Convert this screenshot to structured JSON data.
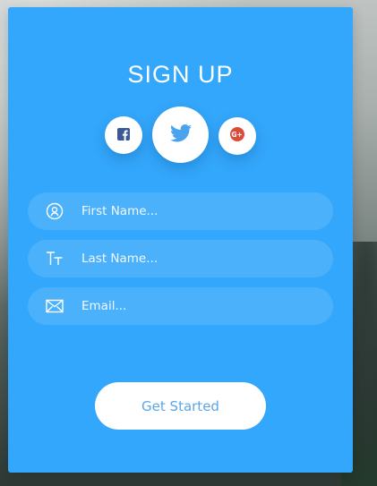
{
  "card": {
    "title": "SIGN UP"
  },
  "social": [
    {
      "network": "facebook",
      "icon": "facebook-icon",
      "color": "#3b5998"
    },
    {
      "network": "twitter",
      "icon": "twitter-icon",
      "color": "#55acee"
    },
    {
      "network": "google-plus",
      "icon": "google-plus-icon",
      "color": "#dd4b39"
    }
  ],
  "fields": {
    "first_name": {
      "icon": "user-circle-icon",
      "placeholder": "First Name..."
    },
    "last_name": {
      "icon": "text-size-icon",
      "placeholder": "Last Name..."
    },
    "email": {
      "icon": "envelope-icon",
      "placeholder": "Email..."
    }
  },
  "cta": {
    "label": "Get Started"
  },
  "colors": {
    "card": "#33a7fb",
    "button_text": "#5aa6e8"
  }
}
